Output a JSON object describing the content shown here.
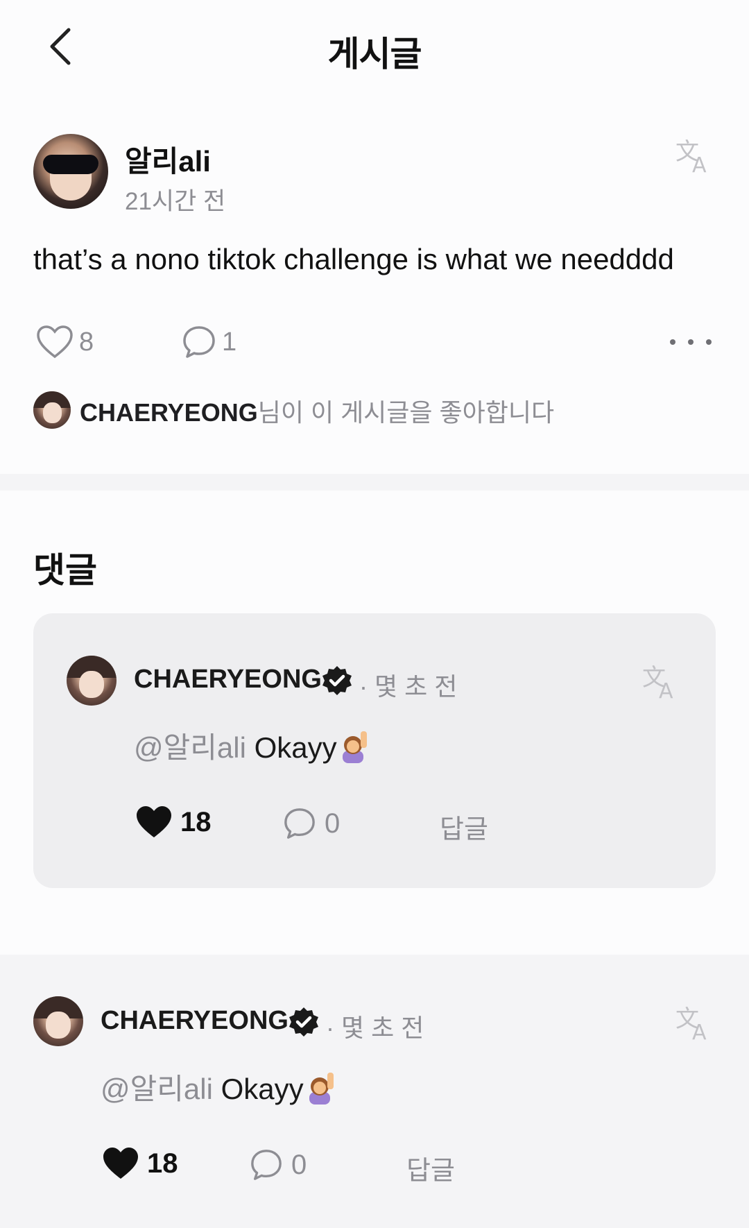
{
  "header": {
    "title": "게시글"
  },
  "post": {
    "author": "알리ali",
    "time": "21시간 전",
    "text": "that’s a nono tiktok challenge is what we needddd",
    "likes": "8",
    "comments": "1",
    "liked_by_name": "CHAERYEONG",
    "liked_by_suffix": "님이 이 게시글을 좋아합니다"
  },
  "comments_section": {
    "title": "댓글"
  },
  "comments": [
    {
      "author": "CHAERYEONG",
      "time": "· 몇 초 전",
      "mention": "@알리ali",
      "text": " Okayy",
      "likes": "18",
      "replies": "0",
      "reply_label": "답글"
    },
    {
      "author": "CHAERYEONG",
      "time": "· 몇 초 전",
      "mention": "@알리ali",
      "text": " Okayy",
      "likes": "18",
      "replies": "0",
      "reply_label": "답글"
    }
  ],
  "colors": {
    "accent_text": "#111111",
    "muted": "#8d8d93",
    "card_bg": "#eeeef0"
  },
  "icons": [
    "back-chevron-icon",
    "translate-icon",
    "heart-outline-icon",
    "comment-bubble-icon",
    "more-dots-icon",
    "verified-badge-icon",
    "heart-filled-icon",
    "raising-hand-emoji"
  ]
}
